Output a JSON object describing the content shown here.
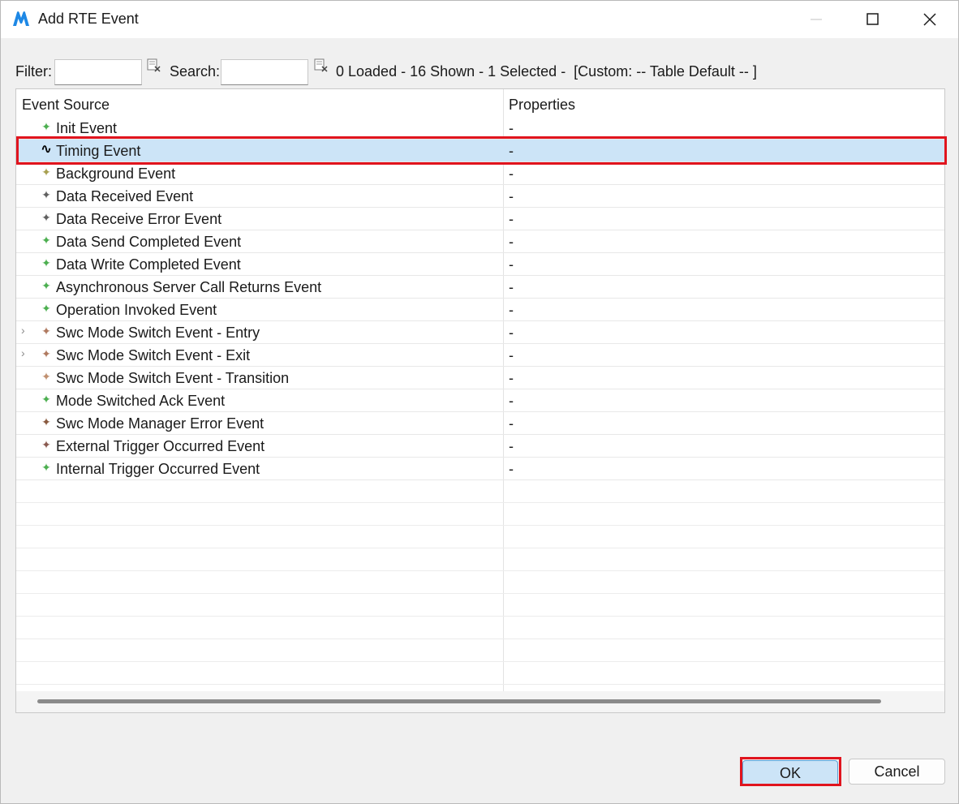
{
  "window": {
    "title": "Add RTE Event",
    "controls": {
      "minimize": "minimize",
      "maximize": "maximize",
      "close": "close"
    }
  },
  "toolbar": {
    "filter_label": "Filter:",
    "filter_value": "",
    "search_label": "Search:",
    "search_value": "",
    "status": "0 Loaded - 16 Shown - 1 Selected -  [Custom: -- Table Default -- ]"
  },
  "table": {
    "columns": [
      "Event Source",
      "Properties"
    ],
    "rows": [
      {
        "name": "Init Event",
        "prop": "-",
        "icon": "sparkle-green",
        "color": "#4caf50",
        "expandable": false,
        "selected": false
      },
      {
        "name": "Timing Event",
        "prop": "-",
        "icon": "wave",
        "color": "#000000",
        "expandable": false,
        "selected": true
      },
      {
        "name": "Background Event",
        "prop": "-",
        "icon": "sparkle-olive",
        "color": "#a8a050",
        "expandable": false,
        "selected": false
      },
      {
        "name": "Data Received Event",
        "prop": "-",
        "icon": "sparkle-gray",
        "color": "#606060",
        "expandable": false,
        "selected": false
      },
      {
        "name": "Data Receive Error Event",
        "prop": "-",
        "icon": "sparkle-gray",
        "color": "#606060",
        "expandable": false,
        "selected": false
      },
      {
        "name": "Data Send Completed Event",
        "prop": "-",
        "icon": "sparkle-green",
        "color": "#4caf50",
        "expandable": false,
        "selected": false
      },
      {
        "name": "Data Write Completed Event",
        "prop": "-",
        "icon": "sparkle-green",
        "color": "#4caf50",
        "expandable": false,
        "selected": false
      },
      {
        "name": "Asynchronous Server Call Returns Event",
        "prop": "-",
        "icon": "sparkle-green",
        "color": "#4caf50",
        "expandable": false,
        "selected": false
      },
      {
        "name": "Operation Invoked Event",
        "prop": "-",
        "icon": "sparkle-green",
        "color": "#4caf50",
        "expandable": false,
        "selected": false
      },
      {
        "name": "Swc Mode Switch Event - Entry",
        "prop": "-",
        "icon": "sparkle-brown",
        "color": "#b07a60",
        "expandable": true,
        "selected": false
      },
      {
        "name": "Swc Mode Switch Event - Exit",
        "prop": "-",
        "icon": "sparkle-brown",
        "color": "#b07a60",
        "expandable": true,
        "selected": false
      },
      {
        "name": "Swc Mode Switch Event - Transition",
        "prop": "-",
        "icon": "sparkle-brown",
        "color": "#c09070",
        "expandable": false,
        "selected": false
      },
      {
        "name": "Mode Switched Ack Event",
        "prop": "-",
        "icon": "sparkle-green",
        "color": "#4caf50",
        "expandable": false,
        "selected": false
      },
      {
        "name": "Swc Mode Manager Error Event",
        "prop": "-",
        "icon": "sparkle-brown",
        "color": "#8a5a40",
        "expandable": false,
        "selected": false
      },
      {
        "name": "External Trigger Occurred Event",
        "prop": "-",
        "icon": "sparkle-brown",
        "color": "#8a5a50",
        "expandable": false,
        "selected": false
      },
      {
        "name": "Internal Trigger Occurred Event",
        "prop": "-",
        "icon": "sparkle-green",
        "color": "#4caf50",
        "expandable": false,
        "selected": false
      }
    ]
  },
  "buttons": {
    "ok": "OK",
    "cancel": "Cancel"
  },
  "colors": {
    "accent": "#cce4f7",
    "highlight": "#e0141e",
    "brand": "#1e88e5"
  }
}
